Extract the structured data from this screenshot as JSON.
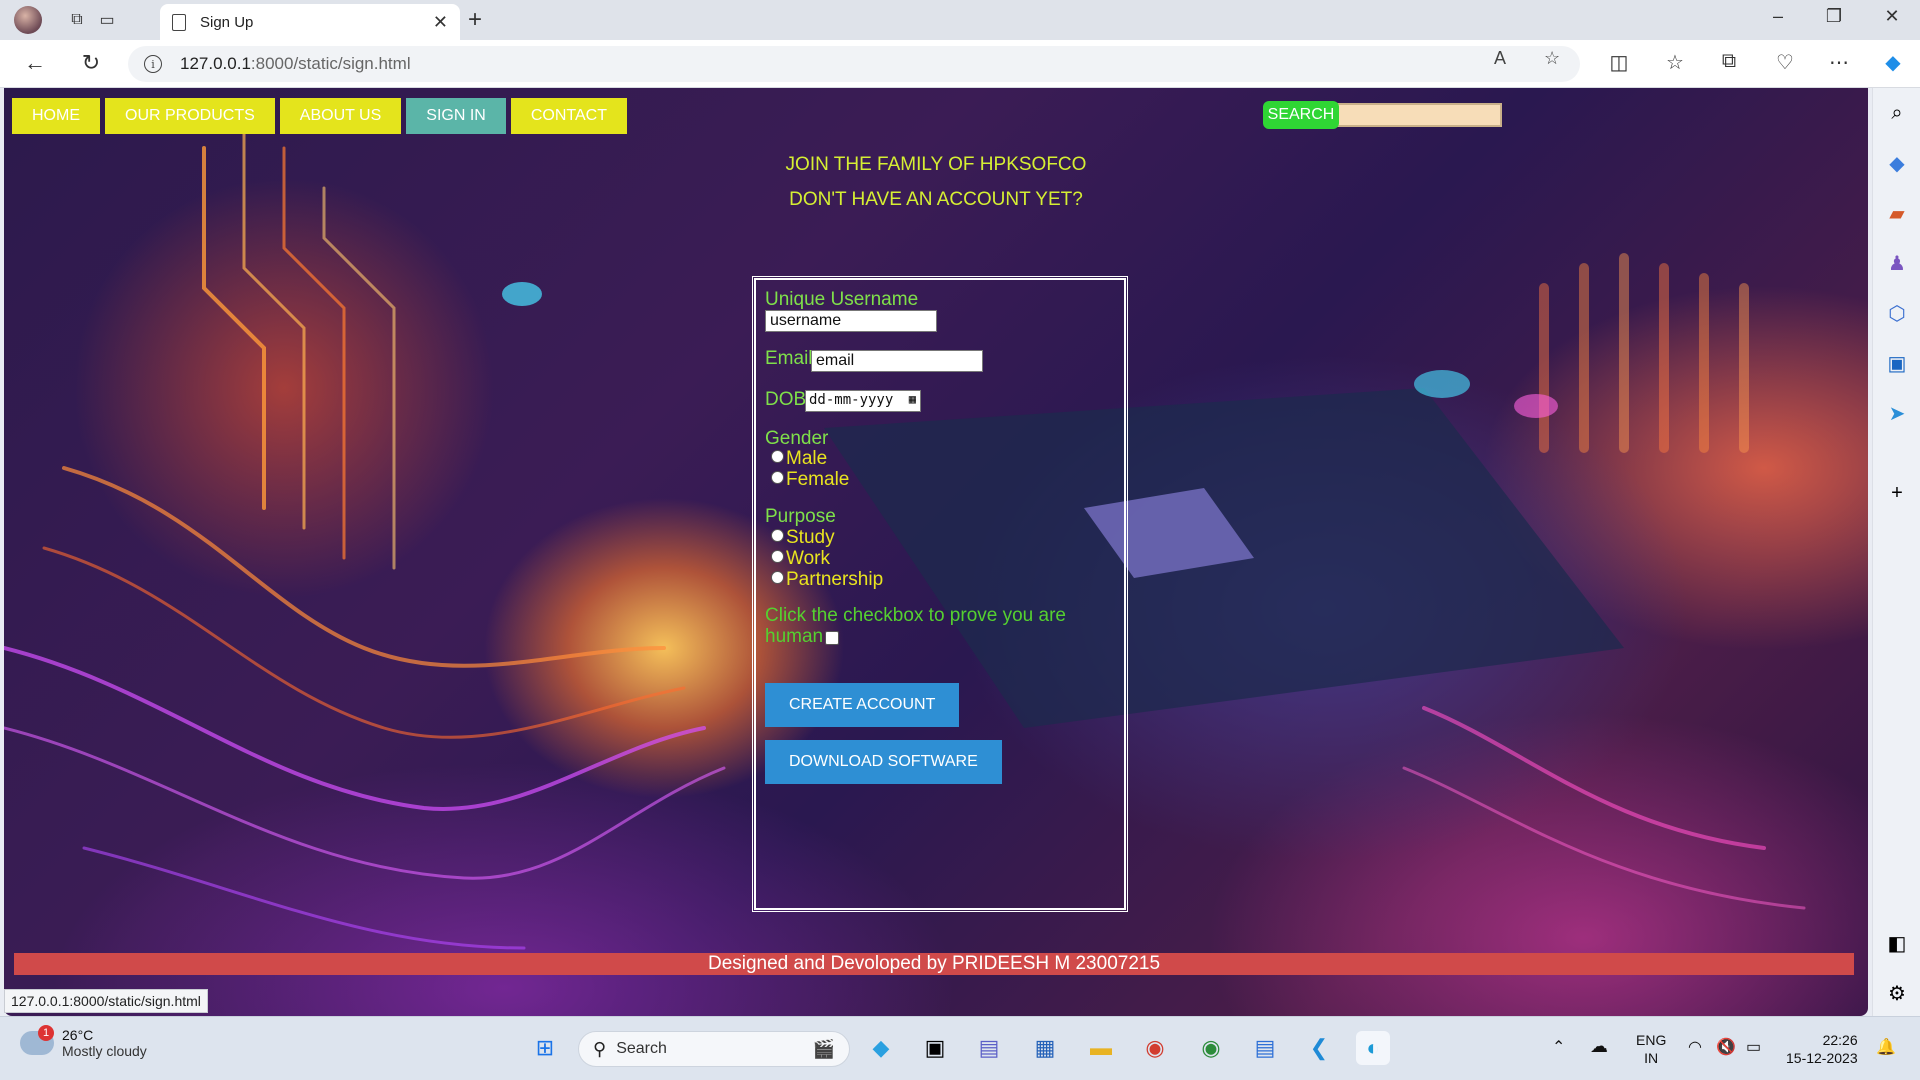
{
  "browser": {
    "tab_title": "Sign Up",
    "url_host": "127.0.0.1",
    "url_rest": ":8000/static/sign.html",
    "status_url": "127.0.0.1:8000/static/sign.html"
  },
  "nav": {
    "items": [
      {
        "label": "HOME",
        "active": false
      },
      {
        "label": "OUR PRODUCTS",
        "active": false
      },
      {
        "label": "ABOUT US",
        "active": false
      },
      {
        "label": "SIGN IN",
        "active": true
      },
      {
        "label": "CONTACT",
        "active": false
      }
    ],
    "search_button": "SEARCH",
    "search_value": ""
  },
  "page": {
    "heading1": "JOIN THE FAMILY OF HPKSOFCO",
    "heading2": "DON'T HAVE AN ACCOUNT YET?"
  },
  "form": {
    "username_label": "Unique Username",
    "username_value": "username",
    "email_label": "Email",
    "email_value": "email",
    "dob_label": "DOB",
    "dob_placeholder": "dd-mm-yyyy",
    "gender_label": "Gender",
    "gender_options": [
      "Male",
      "Female"
    ],
    "purpose_label": "Purpose",
    "purpose_options": [
      "Study",
      "Work",
      "Partnership"
    ],
    "captcha_line1": "Click the checkbox to prove you are",
    "captcha_line2": "human",
    "create_button": "CREATE ACCOUNT",
    "download_button": "DOWNLOAD SOFTWARE"
  },
  "footer": {
    "text": "Designed and Devoloped by PRIDEESH M 23007215"
  },
  "taskbar": {
    "weather_badge": "1",
    "temperature": "26°C",
    "condition": "Mostly cloudy",
    "search_label": "Search",
    "lang_top": "ENG",
    "lang_bottom": "IN",
    "time": "22:26",
    "date": "15-12-2023"
  },
  "colors": {
    "nav_button": "#e4e41c",
    "nav_active": "#5bb5a8",
    "label_green": "#7fe04a",
    "option_yellow": "#e9e41f",
    "form_button": "#2e8fd4",
    "footer_bar": "#d04a4a",
    "search_button": "#2fd634"
  }
}
